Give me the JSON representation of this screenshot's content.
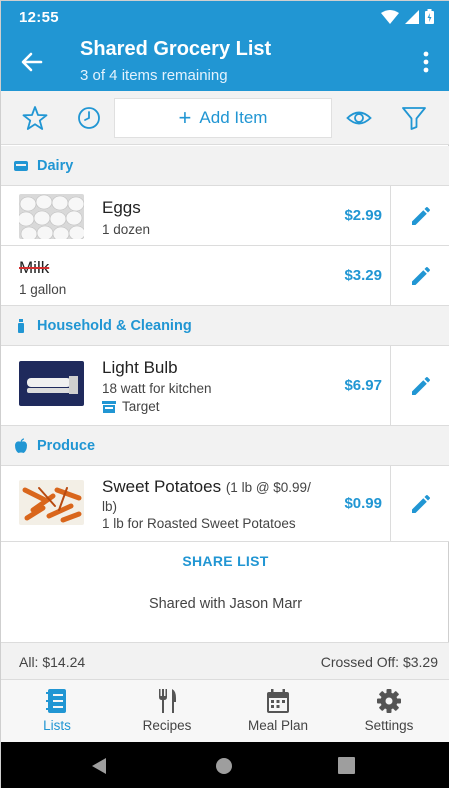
{
  "status_bar": {
    "time": "12:55"
  },
  "app_bar": {
    "title": "Shared Grocery List",
    "subtitle": "3 of 4 items remaining"
  },
  "toolbar": {
    "add_item_label": "Add Item"
  },
  "categories": [
    {
      "name": "Dairy",
      "icon": "dairy-icon",
      "items": [
        {
          "name": "Eggs",
          "quantity": "1 dozen",
          "price": "$2.99",
          "crossed_off": false,
          "thumbnail": "eggs-photo"
        },
        {
          "name": "Milk",
          "quantity": "1 gallon",
          "price": "$3.29",
          "crossed_off": true
        }
      ]
    },
    {
      "name": "Household & Cleaning",
      "icon": "cleaning-icon",
      "items": [
        {
          "name": "Light Bulb",
          "note": "18 watt for kitchen",
          "store": "Target",
          "price": "$6.97",
          "crossed_off": false,
          "thumbnail": "light-bulb-photo"
        }
      ]
    },
    {
      "name": "Produce",
      "icon": "apple-icon",
      "items": [
        {
          "name": "Sweet Potatoes",
          "unit_price_part1": "(1 lb @ $0.99/",
          "unit_price_part2": "lb)",
          "note": "1 lb for Roasted Sweet Potatoes",
          "price": "$0.99",
          "crossed_off": false,
          "thumbnail": "sweet-potatoes-photo"
        }
      ]
    }
  ],
  "share": {
    "button_label": "SHARE LIST",
    "shared_with": "Shared with Jason Marr"
  },
  "totals": {
    "all": "All: $14.24",
    "crossed_off": "Crossed Off: $3.29"
  },
  "bottom_nav": [
    {
      "label": "Lists",
      "icon": "lists-icon",
      "active": true
    },
    {
      "label": "Recipes",
      "icon": "recipes-icon",
      "active": false
    },
    {
      "label": "Meal Plan",
      "icon": "calendar-icon",
      "active": false
    },
    {
      "label": "Settings",
      "icon": "gear-icon",
      "active": false
    }
  ],
  "colors": {
    "accent": "#2196d3",
    "strike": "#d32f2f",
    "header_bg": "#f2f2f2"
  }
}
